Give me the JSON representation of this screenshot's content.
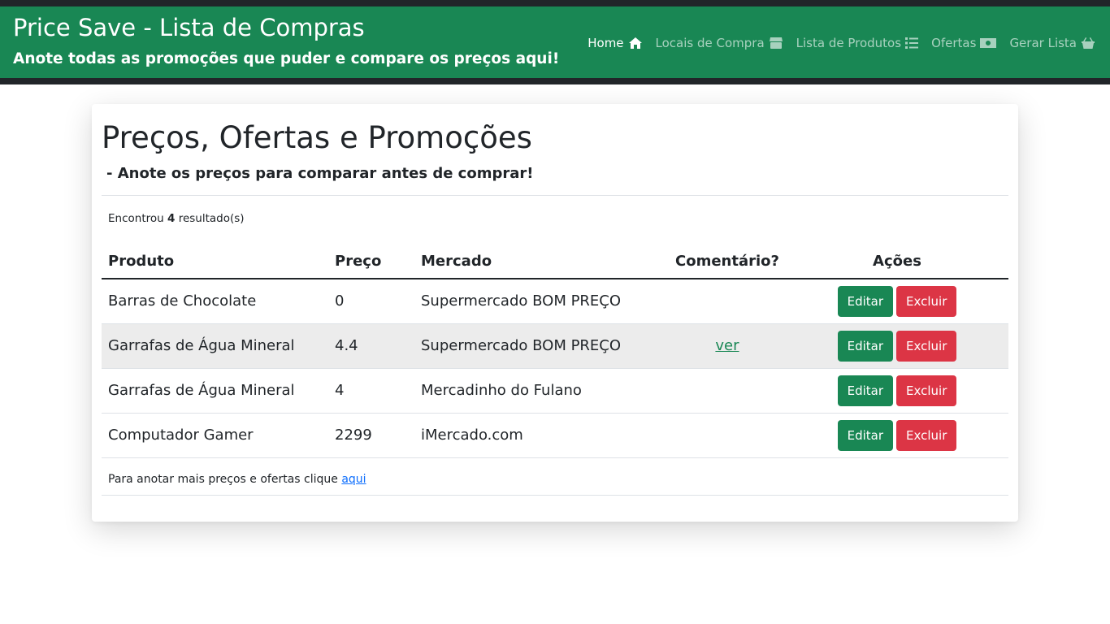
{
  "header": {
    "title": "Price Save - Lista de Compras",
    "subtitle": "Anote todas as promoções que puder e compare os preços aqui!"
  },
  "nav": {
    "items": [
      {
        "label": "Home",
        "icon": "home-icon",
        "active": true
      },
      {
        "label": "Locais de Compra",
        "icon": "store-icon",
        "active": false
      },
      {
        "label": "Lista de Produtos",
        "icon": "list-icon",
        "active": false
      },
      {
        "label": "Ofertas",
        "icon": "money-icon",
        "active": false
      },
      {
        "label": "Gerar Lista",
        "icon": "basket-icon",
        "active": false
      }
    ]
  },
  "main": {
    "title": "Preços, Ofertas e Promoções",
    "subtitle": "- Anote os preços para comparar antes de comprar!",
    "result_prefix": "Encontrou",
    "result_count": "4",
    "result_suffix": "resultado(s)",
    "table": {
      "headers": {
        "produto": "Produto",
        "preco": "Preço",
        "mercado": "Mercado",
        "comentario": "Comentário?",
        "acoes": "Ações"
      },
      "rows": [
        {
          "produto": "Barras de Chocolate",
          "preco": "0",
          "mercado": "Supermercado BOM PREÇO",
          "comentario": ""
        },
        {
          "produto": "Garrafas de Água Mineral",
          "preco": "4.4",
          "mercado": "Supermercado BOM PREÇO",
          "comentario": "ver"
        },
        {
          "produto": "Garrafas de Água Mineral",
          "preco": "4",
          "mercado": "Mercadinho do Fulano",
          "comentario": ""
        },
        {
          "produto": "Computador Gamer",
          "preco": "2299",
          "mercado": "iMercado.com",
          "comentario": ""
        }
      ],
      "edit_label": "Editar",
      "delete_label": "Excluir"
    },
    "footer_text": "Para anotar mais preços e ofertas clique",
    "footer_link": "aqui"
  },
  "colors": {
    "navbar": "#198754",
    "topbar": "#212529",
    "edit_button": "#198754",
    "delete_button": "#dc3545",
    "link": "#0d6efd"
  }
}
